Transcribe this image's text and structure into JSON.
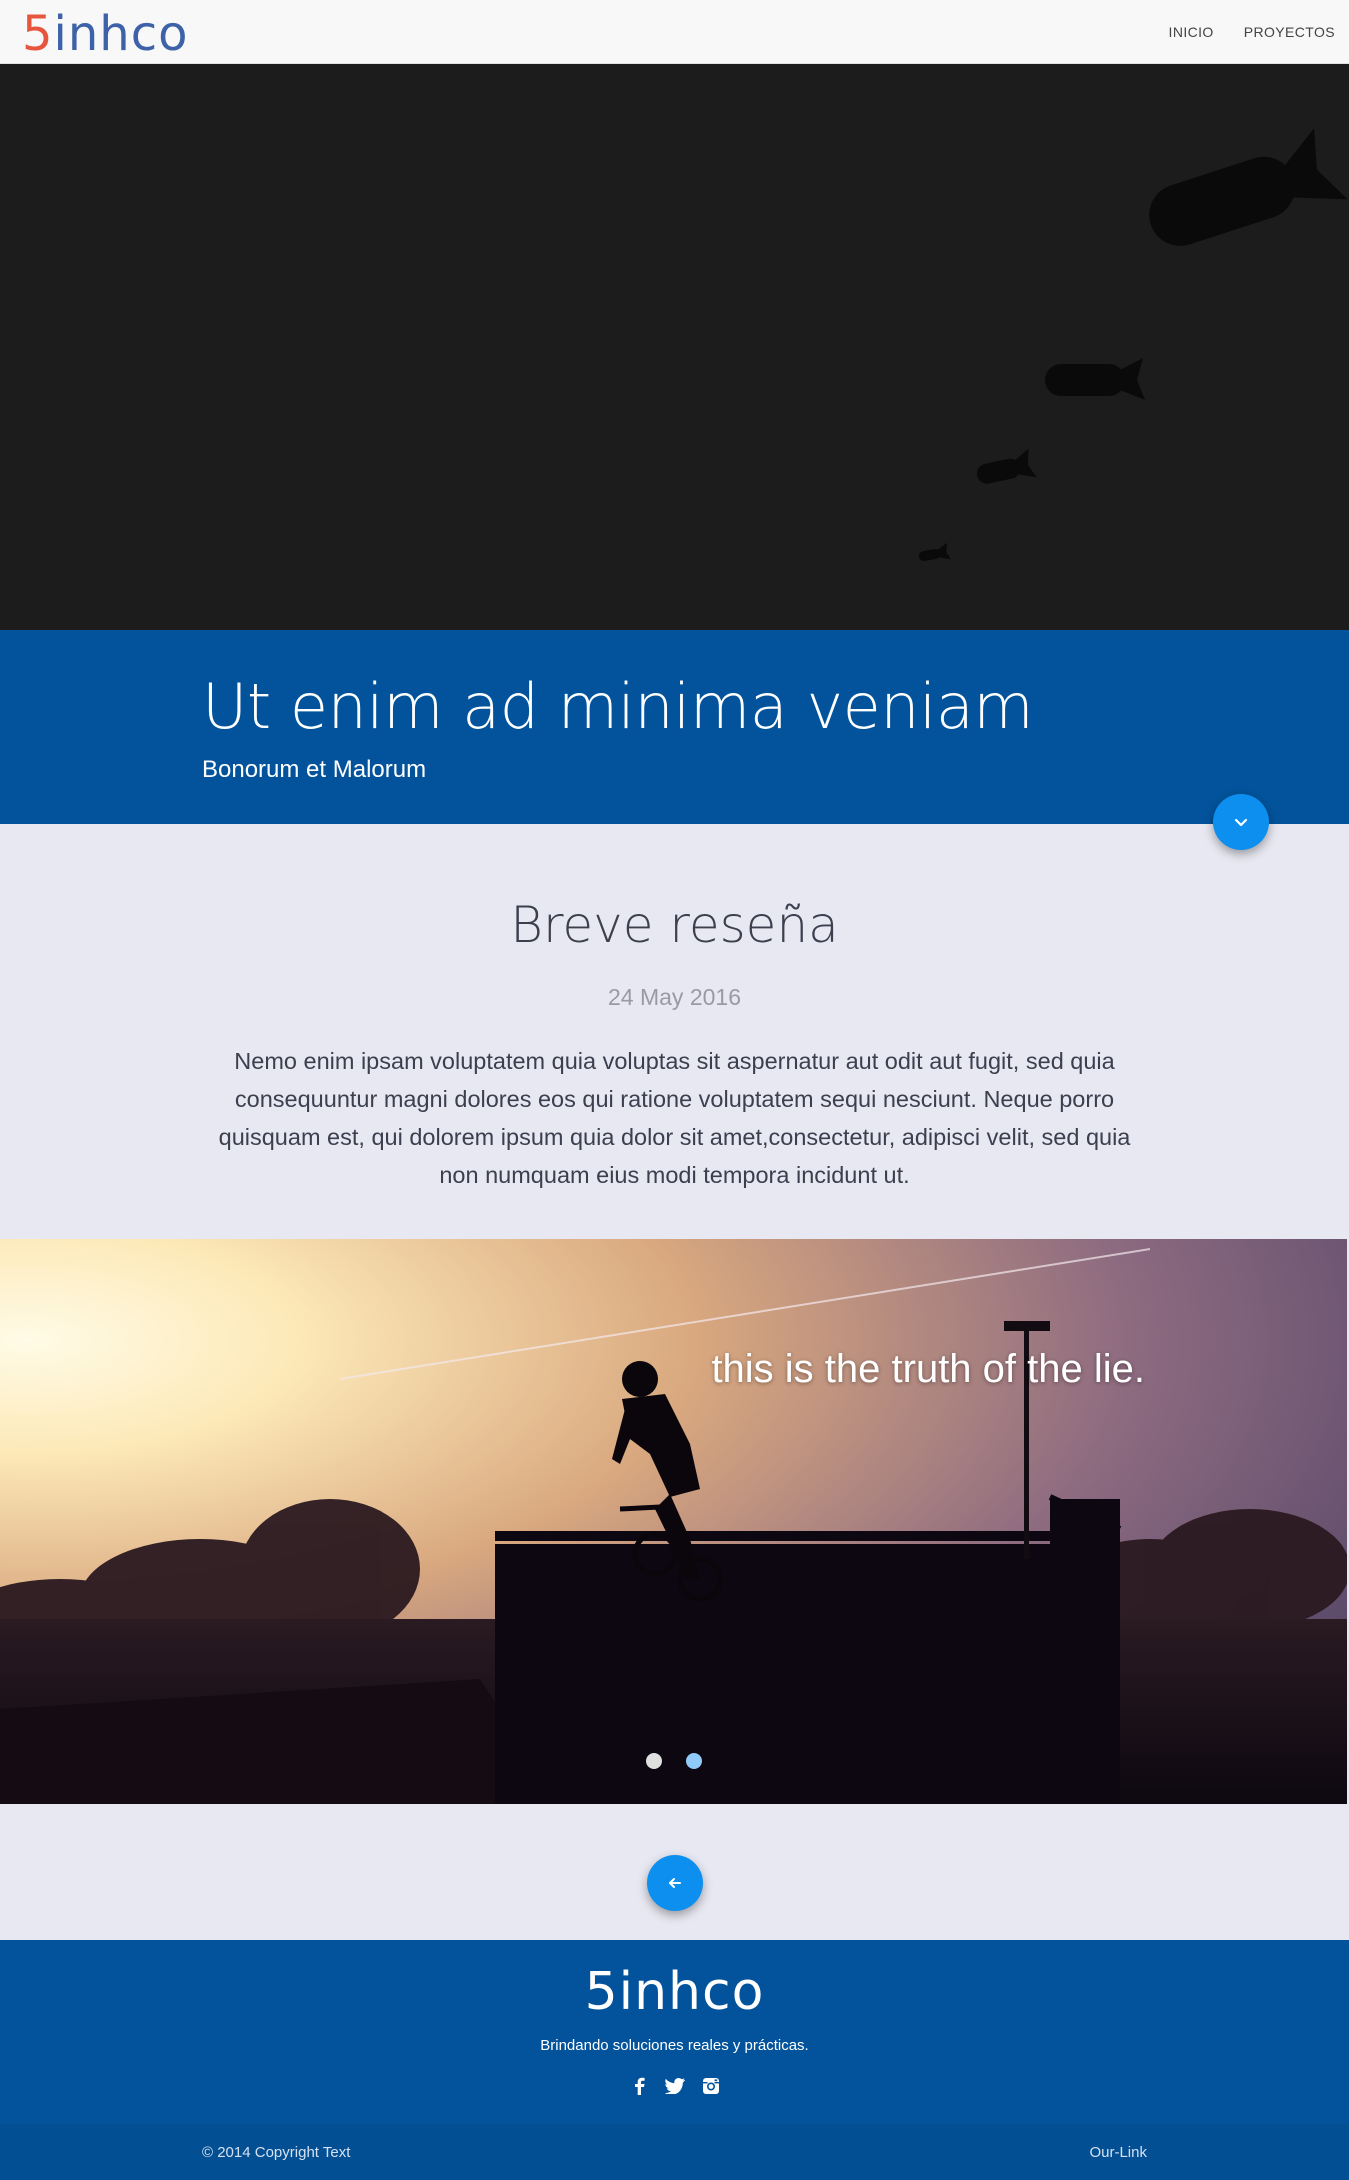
{
  "navbar": {
    "logo_five": "5",
    "logo_rest": "inhco",
    "links": [
      "INICIO",
      "PROYECTOS"
    ]
  },
  "hero": {
    "title": "Ut enim ad minima veniam",
    "subtitle": "Bonorum et Malorum",
    "scroll_icon": "chevron-down-icon"
  },
  "review": {
    "title": "Breve reseña",
    "date": "24 May 2016",
    "text": "Nemo enim ipsam voluptatem quia voluptas sit aspernatur aut odit aut fugit, sed quia consequuntur magni dolores eos qui ratione voluptatem sequi nesciunt. Neque porro quisquam est, qui dolorem ipsum quia dolor sit amet,consectetur, adipisci velit, sed quia non numquam eius modi tempora incidunt ut."
  },
  "carousel": {
    "caption": "this is the truth of the lie.",
    "slides_total": 2,
    "active_slide": 2
  },
  "back_button": {
    "icon": "arrow-left-icon"
  },
  "footer": {
    "logo": "5inhco",
    "tagline": "Brindando soluciones reales y prácticas.",
    "socials": [
      "facebook-icon",
      "twitter-icon",
      "instagram-icon"
    ],
    "copyright": "© 2014 Copyright Text",
    "link": "Our-Link"
  },
  "colors": {
    "brand_blue": "#02539b",
    "accent_blue": "#0d8ff0",
    "logo_red": "#e8553e",
    "logo_blue": "#3d62a8",
    "page_bg": "#e8e8f2"
  }
}
